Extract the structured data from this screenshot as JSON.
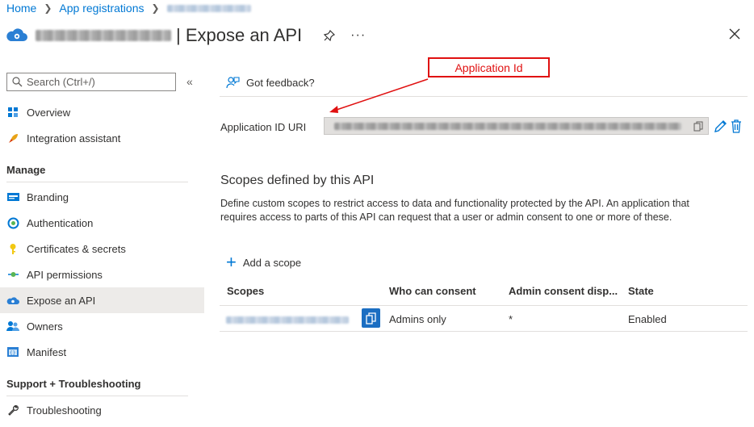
{
  "breadcrumb": {
    "home": "Home",
    "app_registrations": "App registrations"
  },
  "header": {
    "title": "| Expose an API",
    "more": "···"
  },
  "search": {
    "placeholder": "Search (Ctrl+/)",
    "collapse": "«"
  },
  "nav": {
    "top": [
      {
        "label": "Overview",
        "icon": "overview-icon"
      },
      {
        "label": "Integration assistant",
        "icon": "rocket-icon"
      }
    ],
    "manage_title": "Manage",
    "manage": [
      {
        "label": "Branding",
        "icon": "branding-icon"
      },
      {
        "label": "Authentication",
        "icon": "authentication-icon"
      },
      {
        "label": "Certificates & secrets",
        "icon": "key-icon"
      },
      {
        "label": "API permissions",
        "icon": "api-permissions-icon"
      },
      {
        "label": "Expose an API",
        "icon": "cloud-gear-icon",
        "active": true
      },
      {
        "label": "Owners",
        "icon": "owners-icon"
      },
      {
        "label": "Manifest",
        "icon": "manifest-icon"
      }
    ],
    "support_title": "Support + Troubleshooting",
    "support": [
      {
        "label": "Troubleshooting",
        "icon": "wrench-icon"
      }
    ]
  },
  "main": {
    "feedback": "Got feedback?",
    "uri_label": "Application ID URI",
    "annotation": "Application Id",
    "scopes_title": "Scopes defined by this API",
    "scopes_desc": "Define custom scopes to restrict access to data and functionality protected by the API. An application that requires access to parts of this API can request that a user or admin consent to one or more of these.",
    "add_scope": "Add a scope",
    "table": {
      "headers": [
        "Scopes",
        "Who can consent",
        "Admin consent disp...",
        "State"
      ],
      "rows": [
        {
          "who": "Admins only",
          "admin_display": "*",
          "state": "Enabled"
        }
      ]
    }
  },
  "colors": {
    "accent": "#0078d4",
    "annotation": "#e01010",
    "active_nav": "#edebe9"
  }
}
